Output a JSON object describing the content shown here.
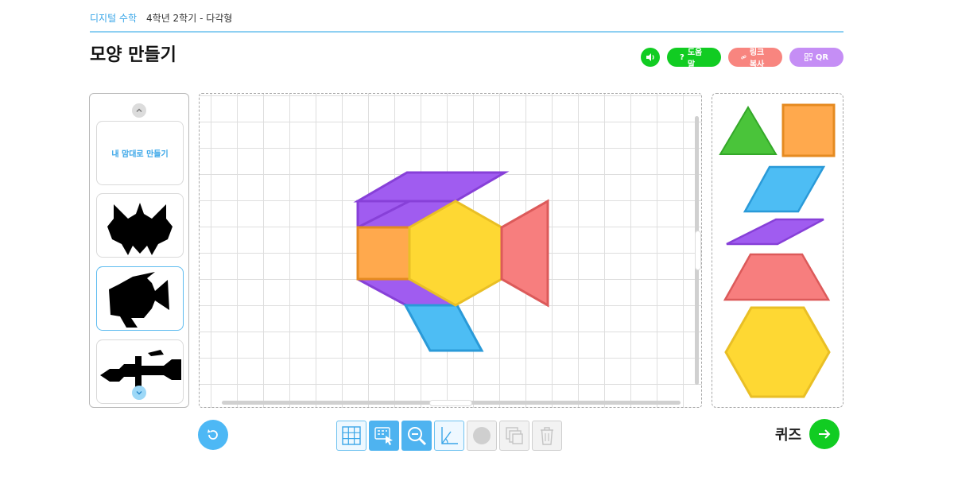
{
  "breadcrumb": {
    "home": "디지털 수학",
    "unit": "4학년 2학기 - 다각형"
  },
  "page": {
    "title": "모양 만들기"
  },
  "actions": {
    "help": "도움말",
    "link_copy": "링크복사",
    "qr": "QR"
  },
  "colors": {
    "accent_blue": "#4db8f5",
    "green": "#11cc22",
    "coral": "#f8857f",
    "purple": "#c58ef5"
  },
  "templates": [
    {
      "label": "내 맘대로 만들기",
      "selected": false
    },
    {
      "label": "",
      "shape": "bat-silhouette",
      "selected": false
    },
    {
      "label": "",
      "shape": "fish-silhouette",
      "selected": true
    },
    {
      "label": "",
      "shape": "airplane-silhouette",
      "selected": false
    }
  ],
  "palette": [
    {
      "name": "triangle",
      "color": "#4ac43a"
    },
    {
      "name": "square",
      "color": "#ffa94d"
    },
    {
      "name": "rhombus-wide",
      "color": "#4dbdf4"
    },
    {
      "name": "rhombus-thin",
      "color": "#a05cf0"
    },
    {
      "name": "trapezoid",
      "color": "#f77e7e"
    },
    {
      "name": "hexagon",
      "color": "#fed833"
    }
  ],
  "toolbar": [
    {
      "name": "grid-tool",
      "state": "on"
    },
    {
      "name": "select-tool",
      "state": "active"
    },
    {
      "name": "zoom-out-tool",
      "state": "active"
    },
    {
      "name": "angle-tool",
      "state": "on"
    },
    {
      "name": "color-tool",
      "state": "disabled"
    },
    {
      "name": "copy-tool",
      "state": "disabled"
    },
    {
      "name": "delete-tool",
      "state": "disabled"
    }
  ],
  "quiz": {
    "label": "퀴즈"
  }
}
